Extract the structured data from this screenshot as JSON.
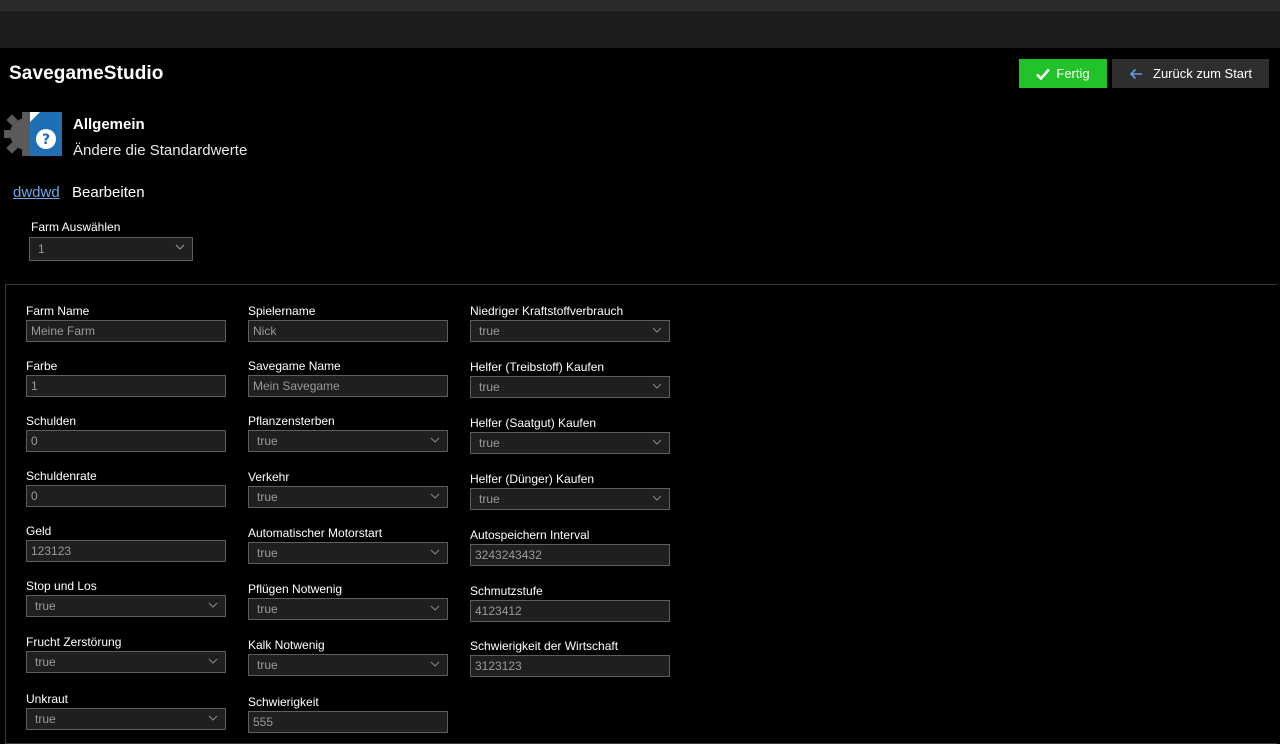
{
  "app": {
    "title": "SavegameStudio",
    "done_label": "Fertig",
    "back_label": "Zurück zum Start"
  },
  "section": {
    "title": "Allgemein",
    "subtitle": "Ändere die Standardwerte"
  },
  "breadcrumb": {
    "link": "dwdwd",
    "label": "Bearbeiten"
  },
  "farm_select": {
    "label": "Farm Auswählen",
    "value": "1"
  },
  "fields": [
    {
      "label": "Farm Name",
      "value": "Meine Farm",
      "type": "text"
    },
    {
      "label": "Farbe",
      "value": "1",
      "type": "text"
    },
    {
      "label": "Schulden",
      "value": "0",
      "type": "text"
    },
    {
      "label": "Schuldenrate",
      "value": "0",
      "type": "text"
    },
    {
      "label": "Geld",
      "value": "123123",
      "type": "text"
    },
    {
      "label": "Stop und Los",
      "value": "true",
      "type": "select"
    },
    {
      "label": "Frucht Zerstörung",
      "value": "true",
      "type": "select"
    },
    {
      "label": "Unkraut",
      "value": "true",
      "type": "select"
    },
    {
      "label": "Spielername",
      "value": "Nick",
      "type": "text"
    },
    {
      "label": "Savegame Name",
      "value": "Mein Savegame",
      "type": "text"
    },
    {
      "label": "Pflanzensterben",
      "value": "true",
      "type": "select"
    },
    {
      "label": "Verkehr",
      "value": "true",
      "type": "select"
    },
    {
      "label": "Automatischer Motorstart",
      "value": "true",
      "type": "select"
    },
    {
      "label": "Pflügen Notwenig",
      "value": "true",
      "type": "select"
    },
    {
      "label": "Kalk Notwenig",
      "value": "true",
      "type": "select"
    },
    {
      "label": "Schwierigkeit",
      "value": "555",
      "type": "text"
    },
    {
      "label": "Niedriger Kraftstoffverbrauch",
      "value": "true",
      "type": "select"
    },
    {
      "label": "Helfer (Treibstoff) Kaufen",
      "value": "true",
      "type": "select"
    },
    {
      "label": "Helfer (Saatgut) Kaufen",
      "value": "true",
      "type": "select"
    },
    {
      "label": "Helfer (Dünger) Kaufen",
      "value": "true",
      "type": "select"
    },
    {
      "label": "Autospeichern Interval",
      "value": "3243243432",
      "type": "text"
    },
    {
      "label": "Schmutzstufe",
      "value": "4123412",
      "type": "text"
    },
    {
      "label": "Schwierigkeit der Wirtschaft",
      "value": "3123123",
      "type": "text"
    }
  ],
  "colors": {
    "accent_green": "#22c32a",
    "link_blue": "#6ea9e6",
    "icon_blue": "#1f6fb5"
  },
  "icons": [
    "check-icon",
    "arrow-left-icon",
    "settings-help-icon",
    "chevron-down-icon"
  ]
}
